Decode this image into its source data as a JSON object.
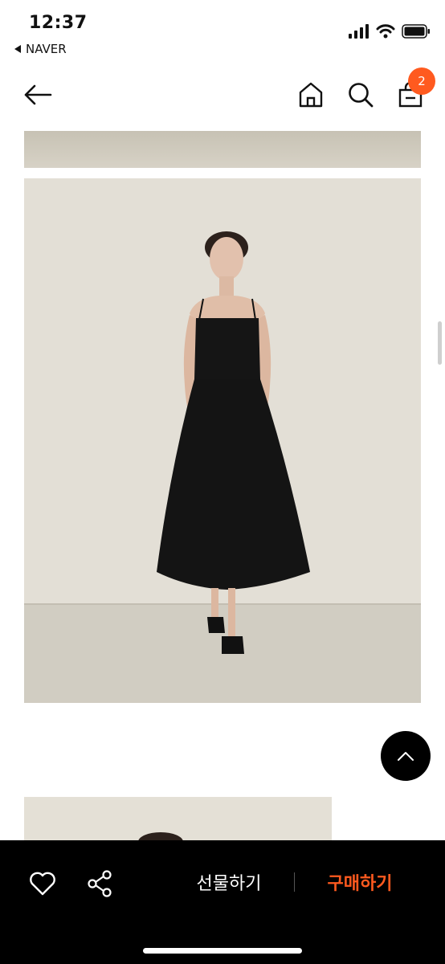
{
  "status_bar": {
    "time": "12:37",
    "back_app": "NAVER"
  },
  "header": {
    "icons": [
      "arrow-left-icon",
      "home-icon",
      "search-icon",
      "shopping-bag-icon"
    ],
    "cart_count": "2"
  },
  "product": {
    "images": [
      "product-photo-strip",
      "product-photo-main",
      "product-photo-next"
    ]
  },
  "bottom_bar": {
    "wishlist_icon": "heart-icon",
    "share_icon": "share-icon",
    "gift_label": "선물하기",
    "buy_label": "구매하기"
  },
  "colors": {
    "accent": "#ff5a1f",
    "bottom_bar_bg": "#000000"
  }
}
